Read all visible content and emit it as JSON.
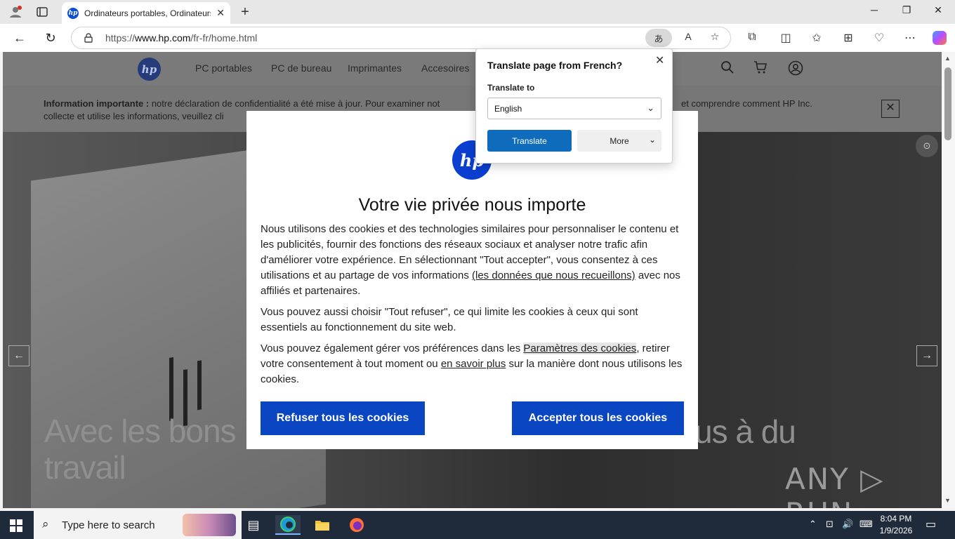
{
  "browser": {
    "tab_title": "Ordinateurs portables, Ordinateurs",
    "url_prefix": "https://",
    "url_domain": "www.hp.com",
    "url_path": "/fr-fr/home.html"
  },
  "hp_nav": {
    "logo_text": "hp",
    "links": [
      "PC portables",
      "PC de bureau",
      "Imprimantes",
      "Accesoires"
    ]
  },
  "info_banner": {
    "bold": "Information importante :",
    "text": " notre déclaration de confidentialité a été mise à jour. Pour examiner not",
    "text_right": "et comprendre comment HP Inc.",
    "line2": "collecte et utilise les informations, veuillez cli"
  },
  "hero": {
    "headline_left": "Avec les bons",
    "headline_line2": "travail",
    "headline_right": "us à du",
    "watermark": "ANY ▷ RUN"
  },
  "cookie_modal": {
    "logo_text": "hp",
    "title": "Votre vie privée nous importe",
    "p1_a": "Nous utilisons des cookies et des technologies similaires pour personnaliser le contenu et les publicités, fournir des fonctions des réseaux sociaux et analyser notre trafic afin d'améliorer votre expérience. En sélectionnant \"Tout accepter\", vous consentez à ces utilisations et au partage de vos informations ",
    "p1_link": "(les données que nous recueillons)",
    "p1_b": " avec nos affiliés et partenaires.",
    "p2": "Vous pouvez aussi choisir \"Tout refuser\", ce qui limite les cookies à ceux qui sont essentiels au fonctionnement du site web.",
    "p3_a": "Vous pouvez également gérer vos préférences dans les ",
    "p3_link1": "Paramètres des cookies",
    "p3_b": ", retirer votre consentement à tout moment ou ",
    "p3_link2": "en savoir plus",
    "p3_c": " sur la manière dont nous utilisons les cookies.",
    "reject_label": "Refuser tous les cookies",
    "accept_label": "Accepter tous les cookies"
  },
  "translate_popup": {
    "title": "Translate page from French?",
    "translate_to_label": "Translate to",
    "selected_language": "English",
    "translate_button": "Translate",
    "more_button": "More"
  },
  "taskbar": {
    "search_placeholder": "Type here to search",
    "time": "8:04 PM",
    "date": "1/9/2026"
  }
}
